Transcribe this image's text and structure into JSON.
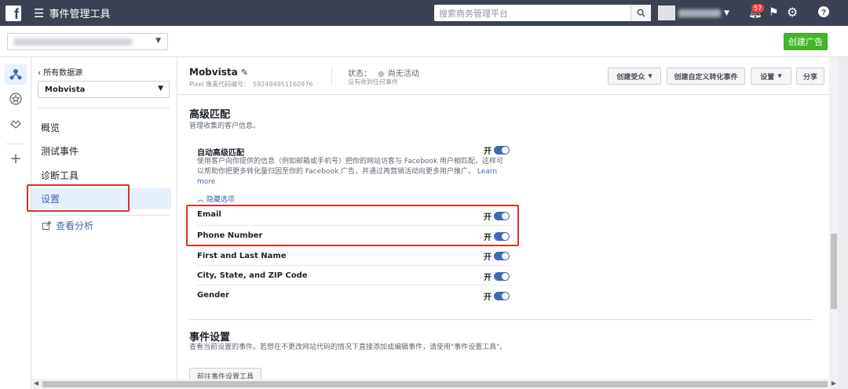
{
  "topbar": {
    "logo": "f",
    "menu_icon": "menu-icon",
    "title": "事件管理工具",
    "search_placeholder": "搜索商务管理平台",
    "notifications_count": "57"
  },
  "subbar": {
    "create_ad_label": "创建广告"
  },
  "sidenav": {
    "back_label": "所有数据源",
    "datasource": "Mobvista",
    "items": [
      {
        "label": "概览"
      },
      {
        "label": "测试事件"
      },
      {
        "label": "诊断工具"
      },
      {
        "label": "设置"
      }
    ],
    "analytics_label": "查看分析"
  },
  "header": {
    "pixel_name": "Mobvista",
    "pixel_id_label": "Pixel 像素代码编号：",
    "pixel_id": "592494951160976",
    "status_label": "状态：",
    "status_value": "尚无活动",
    "status_sub": "没有收到任何事件",
    "buttons": {
      "create_audience": "创建受众",
      "create_conversion": "创建自定义转化事件",
      "settings": "设置",
      "share": "分享"
    }
  },
  "advanced_matching": {
    "title": "高级匹配",
    "subtitle": "管理收集的客户信息。",
    "auto_title": "自动高级匹配",
    "auto_desc": "使用客户向你提供的信息（例如邮箱或手机号）把你的网站访客与 Facebook 用户相匹配，这样可以帮助你把更多转化量归因至你的 Facebook 广告，并通过再营销活动向更多用户推广。",
    "learn_more": "Learn more",
    "hide_options": "隐藏选项",
    "toggle_label": "开",
    "fields": [
      {
        "label": "Email"
      },
      {
        "label": "Phone Number"
      },
      {
        "label": "First and Last Name"
      },
      {
        "label": "City, State, and ZIP Code"
      },
      {
        "label": "Gender"
      }
    ]
  },
  "event_settings": {
    "title": "事件设置",
    "desc": "查看当前设置的事件。若想在不更改网站代码的情况下直接添加或编辑事件，请使用\"事件设置工具\"。",
    "button": "前往事件设置工具"
  },
  "colors": {
    "topbar": "#3b4253",
    "accent": "#4267b2",
    "cta": "#42b72a",
    "highlight": "#d9332b"
  }
}
